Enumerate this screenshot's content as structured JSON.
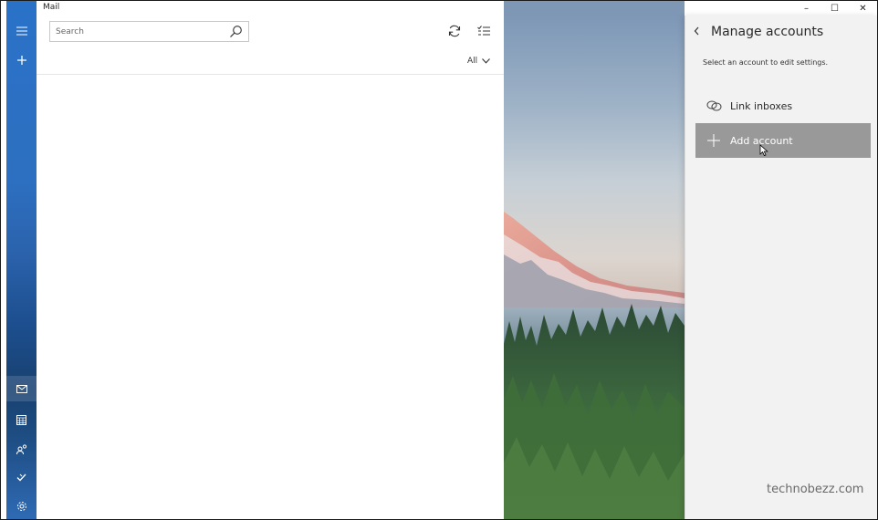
{
  "window": {
    "title": "Mail",
    "controls": {
      "minimize": "–",
      "maximize": "☐",
      "close": "✕"
    }
  },
  "rail": {
    "items": [
      {
        "name": "hamburger-icon",
        "glyph": "☰"
      },
      {
        "name": "new-mail-icon",
        "glyph": "+"
      },
      {
        "name": "mail-icon",
        "glyph": "✉"
      },
      {
        "name": "calendar-icon",
        "glyph": "▦"
      },
      {
        "name": "people-icon",
        "glyph": "⚇"
      },
      {
        "name": "todo-icon",
        "glyph": "✓"
      },
      {
        "name": "settings-icon",
        "glyph": "⚙"
      }
    ]
  },
  "list": {
    "search": {
      "placeholder": "Search",
      "value": ""
    },
    "filter": {
      "label": "All"
    }
  },
  "flyout": {
    "title": "Manage accounts",
    "subtitle": "Select an account to edit settings.",
    "link_inboxes": "Link inboxes",
    "add_account": "Add account",
    "watermark": "technobezz.com"
  },
  "colors": {
    "rail_top": "#2a72c8",
    "rail_bottom": "#17406f",
    "flyout_bg": "#f2f2f2",
    "add_account_bg": "#999999"
  }
}
